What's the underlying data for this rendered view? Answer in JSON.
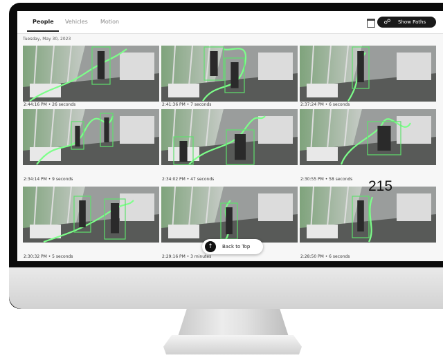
{
  "tabs": [
    {
      "label": "People",
      "active": true
    },
    {
      "label": "Vehicles",
      "active": false
    },
    {
      "label": "Motion",
      "active": false
    }
  ],
  "toolbar": {
    "calendar_icon": "calendar-icon",
    "show_paths_label": "Show Paths",
    "show_paths_icon": "paths-icon"
  },
  "date": "Tuesday, May 30, 2023",
  "clips": [
    {
      "caption": "2:44:16 PM • 26 seconds"
    },
    {
      "caption": "2:41:36 PM • 7 seconds"
    },
    {
      "caption": "2:37:24 PM • 6 seconds"
    },
    {
      "caption": "2:34:14 PM • 9 seconds"
    },
    {
      "caption": "2:34:02 PM • 47 seconds"
    },
    {
      "caption": "2:30:55 PM • 58 seconds"
    },
    {
      "caption": "2:30:32 PM • 5 seconds"
    },
    {
      "caption": "2:29:16 PM • 3 minutes"
    },
    {
      "caption": "2:28:50 PM • 6 seconds"
    }
  ],
  "back_to_top_label": "Back to Top",
  "overlay_number": "215",
  "colors": {
    "path": "#7dff8a",
    "box": "#5fe06d",
    "accent": "#1a1a1a"
  }
}
